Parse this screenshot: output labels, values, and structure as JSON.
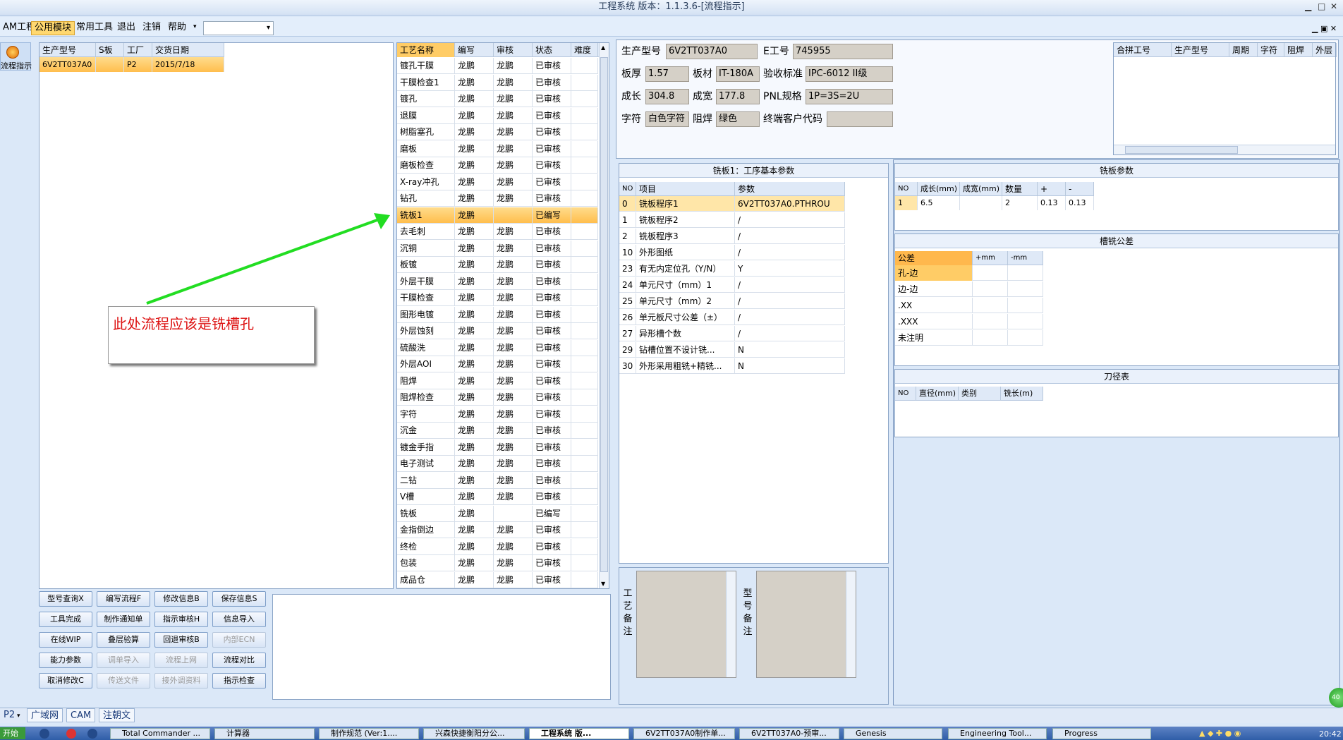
{
  "window": {
    "title": "工程系统 版本：1.1.3.6-[流程指示]"
  },
  "menubar": {
    "items": [
      "AM工程",
      "公用模块",
      "常用工具",
      "退出",
      "注销",
      "帮助"
    ],
    "active": "公用模块"
  },
  "left_tool": {
    "label": "流程指示"
  },
  "order_table": {
    "headers": [
      "生产型号",
      "S板",
      "工厂",
      "交货日期"
    ],
    "rows": [
      [
        "6V2TT037A0",
        "",
        "P2",
        "2015/7/18"
      ]
    ]
  },
  "process_table": {
    "headers": [
      "工艺名称",
      "编写",
      "审核",
      "状态",
      "难度"
    ],
    "rows": [
      [
        "镀孔干膜",
        "龙鹏",
        "龙鹏",
        "已审核"
      ],
      [
        "干膜检查1",
        "龙鹏",
        "龙鹏",
        "已审核"
      ],
      [
        "镀孔",
        "龙鹏",
        "龙鹏",
        "已审核"
      ],
      [
        "退膜",
        "龙鹏",
        "龙鹏",
        "已审核"
      ],
      [
        "树脂塞孔",
        "龙鹏",
        "龙鹏",
        "已审核"
      ],
      [
        "磨板",
        "龙鹏",
        "龙鹏",
        "已审核"
      ],
      [
        "磨板检查",
        "龙鹏",
        "龙鹏",
        "已审核"
      ],
      [
        "X-ray冲孔",
        "龙鹏",
        "龙鹏",
        "已审核"
      ],
      [
        "钻孔",
        "龙鹏",
        "龙鹏",
        "已审核"
      ],
      [
        "铣板1",
        "龙鹏",
        "",
        "已编写"
      ],
      [
        "去毛刺",
        "龙鹏",
        "龙鹏",
        "已审核"
      ],
      [
        "沉铜",
        "龙鹏",
        "龙鹏",
        "已审核"
      ],
      [
        "板镀",
        "龙鹏",
        "龙鹏",
        "已审核"
      ],
      [
        "外层干膜",
        "龙鹏",
        "龙鹏",
        "已审核"
      ],
      [
        "干膜检查",
        "龙鹏",
        "龙鹏",
        "已审核"
      ],
      [
        "图形电镀",
        "龙鹏",
        "龙鹏",
        "已审核"
      ],
      [
        "外层蚀刻",
        "龙鹏",
        "龙鹏",
        "已审核"
      ],
      [
        "硫酸洗",
        "龙鹏",
        "龙鹏",
        "已审核"
      ],
      [
        "外层AOI",
        "龙鹏",
        "龙鹏",
        "已审核"
      ],
      [
        "阻焊",
        "龙鹏",
        "龙鹏",
        "已审核"
      ],
      [
        "阻焊检查",
        "龙鹏",
        "龙鹏",
        "已审核"
      ],
      [
        "字符",
        "龙鹏",
        "龙鹏",
        "已审核"
      ],
      [
        "沉金",
        "龙鹏",
        "龙鹏",
        "已审核"
      ],
      [
        "镀金手指",
        "龙鹏",
        "龙鹏",
        "已审核"
      ],
      [
        "电子测试",
        "龙鹏",
        "龙鹏",
        "已审核"
      ],
      [
        "二钻",
        "龙鹏",
        "龙鹏",
        "已审核"
      ],
      [
        "V槽",
        "龙鹏",
        "龙鹏",
        "已审核"
      ],
      [
        "铣板",
        "龙鹏",
        "",
        "已编写"
      ],
      [
        "金指倒边",
        "龙鹏",
        "龙鹏",
        "已审核"
      ],
      [
        "终检",
        "龙鹏",
        "龙鹏",
        "已审核"
      ],
      [
        "包装",
        "龙鹏",
        "龙鹏",
        "已审核"
      ],
      [
        "成品仓",
        "龙鹏",
        "龙鹏",
        "已审核"
      ]
    ],
    "selected_index": 9
  },
  "annotation": {
    "text": "此处流程应该是铣槽孔",
    "arrow_color": "#22dd22"
  },
  "info": {
    "model_label": "生产型号",
    "model": "6V2TT037A0",
    "ejob_label": "E工号",
    "ejob": "745955",
    "thick_label": "板厚",
    "thick": "1.57",
    "material_label": "板材",
    "material": "IT-180A",
    "std_label": "验收标准",
    "std": "IPC-6012 II级",
    "len_label": "成长",
    "len": "304.8",
    "wid_label": "成宽",
    "wid": "177.8",
    "pnl_label": "PNL规格",
    "pnl": "1P=3S=2U",
    "char_label": "字符",
    "char": "白色字符",
    "mask_label": "阻焊",
    "mask": "绿色",
    "cust_label": "终端客户代码",
    "cust": ""
  },
  "merge_table": {
    "headers": [
      "合拼工号",
      "生产型号",
      "周期",
      "字符",
      "阻焊",
      "外层"
    ]
  },
  "basic_params": {
    "title": "铣板1：工序基本参数",
    "headers": [
      "NO",
      "项目",
      "参数"
    ],
    "rows": [
      [
        "0",
        "铣板程序1",
        "6V2TT037A0.PTHROU"
      ],
      [
        "1",
        "铣板程序2",
        "/"
      ],
      [
        "2",
        "铣板程序3",
        "/"
      ],
      [
        "10",
        "外形图纸",
        "/"
      ],
      [
        "23",
        "有无内定位孔（Y/N）",
        "Y"
      ],
      [
        "24",
        "单元尺寸（mm）1",
        "/"
      ],
      [
        "25",
        "单元尺寸（mm）2",
        "/"
      ],
      [
        "26",
        "单元板尺寸公差（±）",
        "/"
      ],
      [
        "27",
        "异形槽个数",
        "/"
      ],
      [
        "29",
        "钻槽位置不设计铣...",
        "N"
      ],
      [
        "30",
        "外形采用粗铣+精铣...",
        "N"
      ]
    ]
  },
  "mill_params": {
    "title": "铣板参数",
    "headers": [
      "NO",
      "成长(mm)",
      "成宽(mm)",
      "数量",
      "+",
      "-"
    ],
    "rows": [
      [
        "1",
        "6.5",
        "",
        "2",
        "0.13",
        "0.13"
      ]
    ]
  },
  "slot_tol": {
    "title": "槽铣公差",
    "headers": [
      "公差",
      "+mm",
      "-mm"
    ],
    "rows": [
      [
        "孔-边"
      ],
      [
        "边-边"
      ],
      [
        ".XX"
      ],
      [
        ".XXX"
      ],
      [
        "未注明"
      ]
    ]
  },
  "tool_table": {
    "title": "刀径表",
    "headers": [
      "NO",
      "直径(mm)",
      "类别",
      "铣长(m)"
    ]
  },
  "remarks": {
    "process_label": "工艺备注",
    "model_label": "型号备注"
  },
  "buttons": [
    [
      "型号查询X",
      "编写流程F",
      "修改信息B",
      "保存信息S"
    ],
    [
      "工具完成",
      "制作通知单",
      "指示审核H",
      "信息导入"
    ],
    [
      "在线WIP",
      "叠层验算",
      "回退审核B",
      "内部ECN"
    ],
    [
      "能力参数",
      "调单导入",
      "流程上网",
      "流程对比"
    ],
    [
      "取消修改C",
      "传送文件",
      "接外调资料",
      "指示检查"
    ]
  ],
  "disabled_buttons": [
    "内部ECN",
    "调单导入",
    "流程上网",
    "传送文件",
    "接外调资料"
  ],
  "bottom_tabs": [
    "P2",
    "广域网",
    "CAM",
    "注朝文"
  ],
  "taskbar": {
    "start": "开始",
    "items": [
      "Total Commander ...",
      "计算器",
      "制作规范 (Ver:1....",
      "兴森快捷衡阳分公...",
      "工程系统 版...",
      "6V2TT037A0制作单...",
      "6V2TT037A0-预审...",
      "Genesis",
      "Engineering Tool...",
      "Progress"
    ],
    "active_index": 4,
    "clock": "20:42"
  }
}
